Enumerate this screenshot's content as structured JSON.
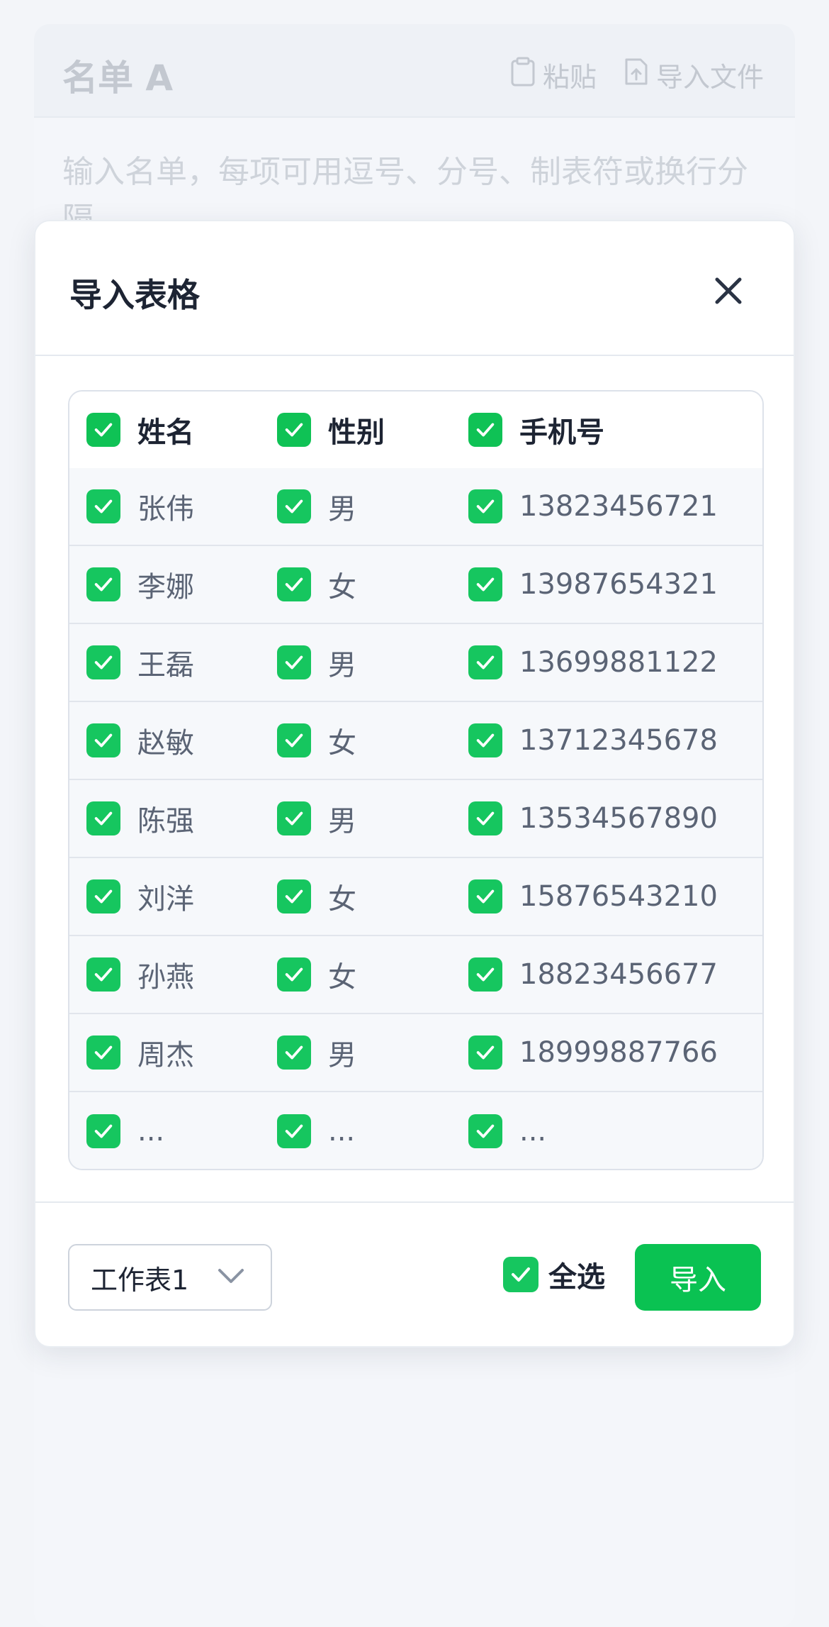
{
  "background": {
    "title": "名单 A",
    "paste_label": "粘贴",
    "import_file_label": "导入文件",
    "placeholder": "输入名单，每项可用逗号、分号、制表符或换行分隔"
  },
  "modal": {
    "title": "导入表格",
    "columns": [
      "姓名",
      "性别",
      "手机号"
    ],
    "rows": [
      [
        "张伟",
        "男",
        "13823456721"
      ],
      [
        "李娜",
        "女",
        "13987654321"
      ],
      [
        "王磊",
        "男",
        "13699881122"
      ],
      [
        "赵敏",
        "女",
        "13712345678"
      ],
      [
        "陈强",
        "男",
        "13534567890"
      ],
      [
        "刘洋",
        "女",
        "15876543210"
      ],
      [
        "孙燕",
        "女",
        "18823456677"
      ],
      [
        "周杰",
        "男",
        "18999887766"
      ],
      [
        "...",
        "...",
        "..."
      ]
    ],
    "sheet_select": "工作表1",
    "select_all_label": "全选",
    "import_button": "导入"
  },
  "colors": {
    "accent": "#0ac252",
    "checkbox": "#16c65f",
    "text_primary": "#1d2433",
    "text_secondary": "#5b6475"
  },
  "icons": [
    "clipboard-icon",
    "file-upload-icon",
    "close-icon",
    "check-icon",
    "chevron-down-icon"
  ]
}
